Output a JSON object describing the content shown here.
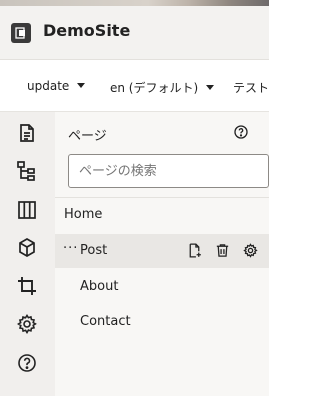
{
  "header": {
    "site_title": "DemoSite",
    "logo_icon": "site-logo-icon"
  },
  "toolbar": {
    "update_label": "update",
    "language_label": "en (デフォルト)",
    "test_label": "テスト"
  },
  "sidebar": {
    "items": [
      {
        "name": "pages",
        "icon": "pages-icon"
      },
      {
        "name": "structure",
        "icon": "hierarchy-icon"
      },
      {
        "name": "layout",
        "icon": "columns-icon"
      },
      {
        "name": "components",
        "icon": "cube-icon"
      },
      {
        "name": "crop",
        "icon": "crop-icon"
      },
      {
        "name": "settings",
        "icon": "gear-icon"
      },
      {
        "name": "help",
        "icon": "help-icon"
      }
    ]
  },
  "panel": {
    "title": "ページ",
    "search_placeholder": "ページの検索",
    "tree": [
      {
        "label": "Home",
        "level": 0,
        "selected": false
      },
      {
        "label": "Post",
        "level": 0,
        "selected": true,
        "prefix": "···"
      },
      {
        "label": "About",
        "level": 1,
        "selected": false
      },
      {
        "label": "Contact",
        "level": 1,
        "selected": false
      }
    ]
  },
  "colors": {
    "sidebar_bg": "#f1efed",
    "panel_bg": "#f8f7f5",
    "selected_row": "#e9e7e4"
  }
}
